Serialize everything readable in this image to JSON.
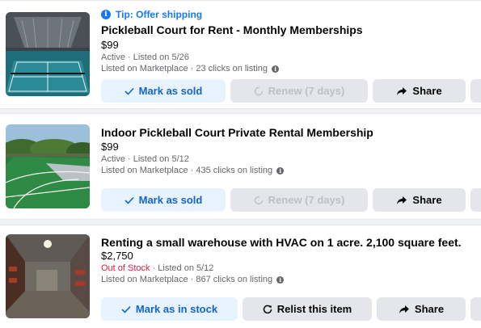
{
  "listings": [
    {
      "tip": "Tip: Offer shipping",
      "title": "Pickleball Court for Rent - Monthly Memberships",
      "price": "$99",
      "status": "Active",
      "listed": " · Listed on 5/26",
      "marketplace": "Listed on Marketplace · 23 clicks on listing",
      "primary_label": "Mark as sold",
      "secondary_label": "Renew (7 days)",
      "share_label": "Share"
    },
    {
      "title": "Indoor Pickleball Court Private Rental Membership",
      "price": "$99",
      "status": "Active",
      "listed": " · Listed on 5/12",
      "marketplace": "Listed on Marketplace · 435 clicks on listing",
      "primary_label": "Mark as sold",
      "secondary_label": "Renew (7 days)",
      "share_label": "Share"
    },
    {
      "title": "Renting a small warehouse with HVAC on 1 acre. 2,100 square feet.",
      "price": "$2,750",
      "status": "Out of Stock",
      "listed": " · Listed on 5/12",
      "marketplace": "Listed on Marketplace · 867 clicks on listing",
      "primary_label": "Mark as in stock",
      "secondary_label": "Relist this item",
      "share_label": "Share"
    }
  ],
  "colors": {
    "accent": "#1877f2",
    "primary_button_bg": "#e7f3ff",
    "primary_button_text": "#1464cc",
    "out_of_stock": "#e41e3f",
    "muted_text": "#65676b"
  },
  "icons": [
    "info-icon",
    "checkmark-icon",
    "renew-icon",
    "relist-icon",
    "share-icon"
  ]
}
